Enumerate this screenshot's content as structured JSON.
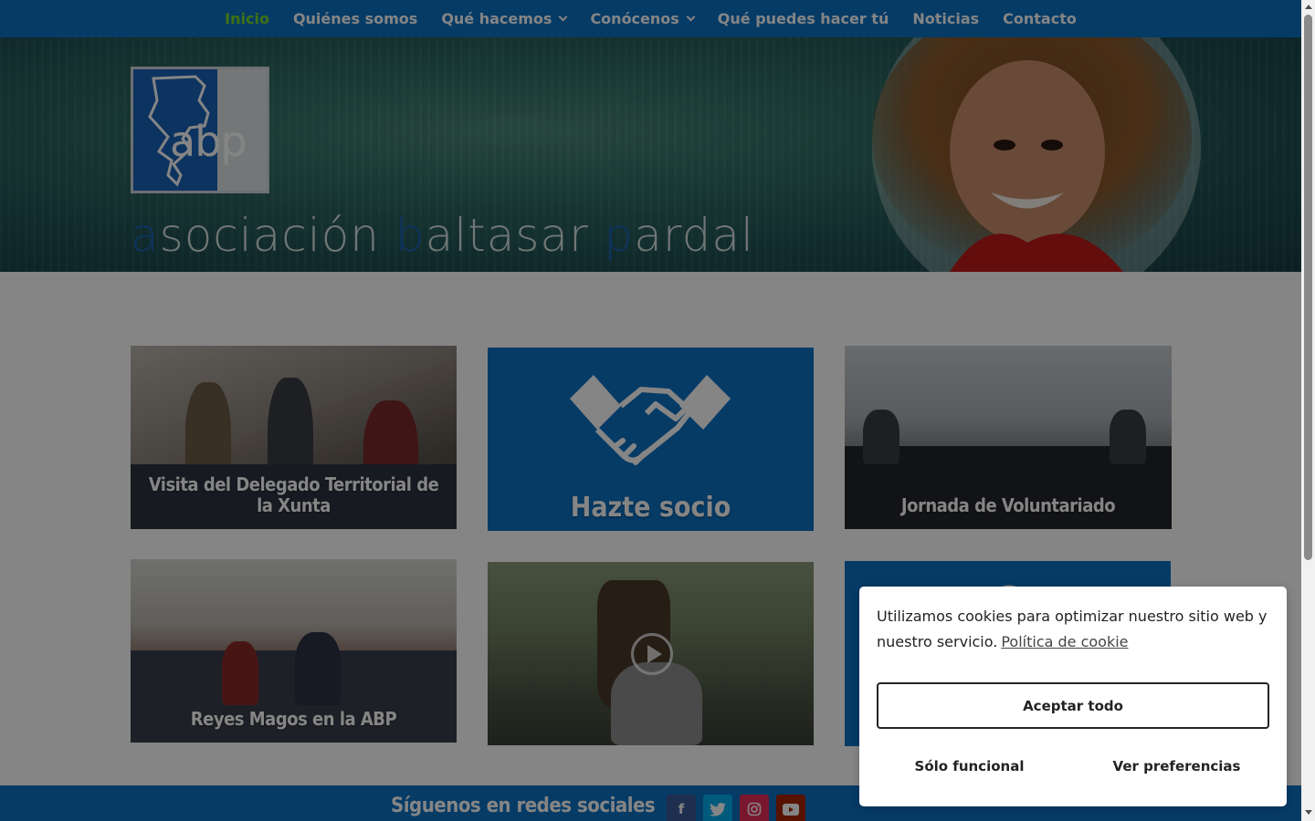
{
  "nav": {
    "items": [
      {
        "label": "Inicio",
        "active": true,
        "dropdown": false
      },
      {
        "label": "Quiénes somos",
        "active": false,
        "dropdown": false
      },
      {
        "label": "Qué hacemos",
        "active": false,
        "dropdown": true
      },
      {
        "label": "Conócenos",
        "active": false,
        "dropdown": true
      },
      {
        "label": "Qué puedes hacer tú",
        "active": false,
        "dropdown": false
      },
      {
        "label": "Noticias",
        "active": false,
        "dropdown": false
      },
      {
        "label": "Contacto",
        "active": false,
        "dropdown": false
      }
    ]
  },
  "hero": {
    "logo_text": "abp",
    "title_parts": [
      "a",
      "sociación ",
      "b",
      "altasar ",
      "p",
      "ardal"
    ]
  },
  "tiles": {
    "visita": "Visita del Delegado Territorial de la Xunta",
    "hazte": "Hazte socio",
    "jornada": "Jornada de Voluntariado",
    "reyes": "Reyes Magos en la ABP"
  },
  "social": {
    "title": "Síguenos en redes sociales",
    "networks": [
      "facebook-icon",
      "twitter-icon",
      "instagram-icon",
      "youtube-icon"
    ]
  },
  "cookie": {
    "message": "Utilizamos cookies para optimizar nuestro sitio web y nuestro servicio.",
    "policy_link": "Política de cookie",
    "accept": "Aceptar todo",
    "functional": "Sólo funcional",
    "preferences": "Ver preferencias"
  },
  "colors": {
    "brand_blue": "#0c71c3",
    "active_nav": "#7cda24"
  }
}
